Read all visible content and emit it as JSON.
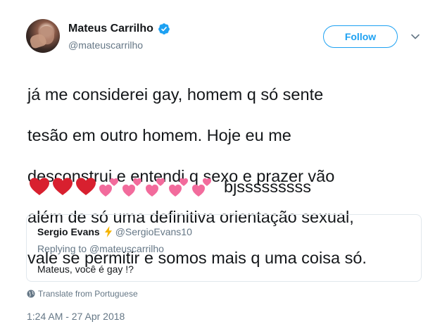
{
  "author": {
    "name": "Mateus Carrilho",
    "handle": "@mateuscarrilho",
    "verified": true
  },
  "follow_button": "Follow",
  "tweet": {
    "lines": [
      "já me considerei gay, homem q só sente",
      "tesão em outro homem. Hoje eu me",
      "desconstrui e entendi q sexo e prazer vão",
      "além de só uma definitiva orientação sexual,",
      "vale se permitir e somos mais q uma coisa só."
    ],
    "emojis": [
      "red-heart",
      "red-heart",
      "red-heart",
      "two-hearts",
      "two-hearts",
      "two-hearts",
      "two-hearts",
      "two-hearts"
    ],
    "tail_text": "bjsssssssss"
  },
  "quoted": {
    "name": "Sergio Evans",
    "handle": "@SergioEvans10",
    "replying_prefix": "Replying to ",
    "replying_handle": "@mateuscarrilho",
    "text": "Mateus, você é gay !?"
  },
  "translate": "Translate from Portuguese",
  "timestamp": "1:24 AM - 27 Apr 2018",
  "colors": {
    "accent": "#1da1f2",
    "heart_red": "#d8202f",
    "heart_pink": "#f26b9c",
    "muted": "#657786"
  }
}
